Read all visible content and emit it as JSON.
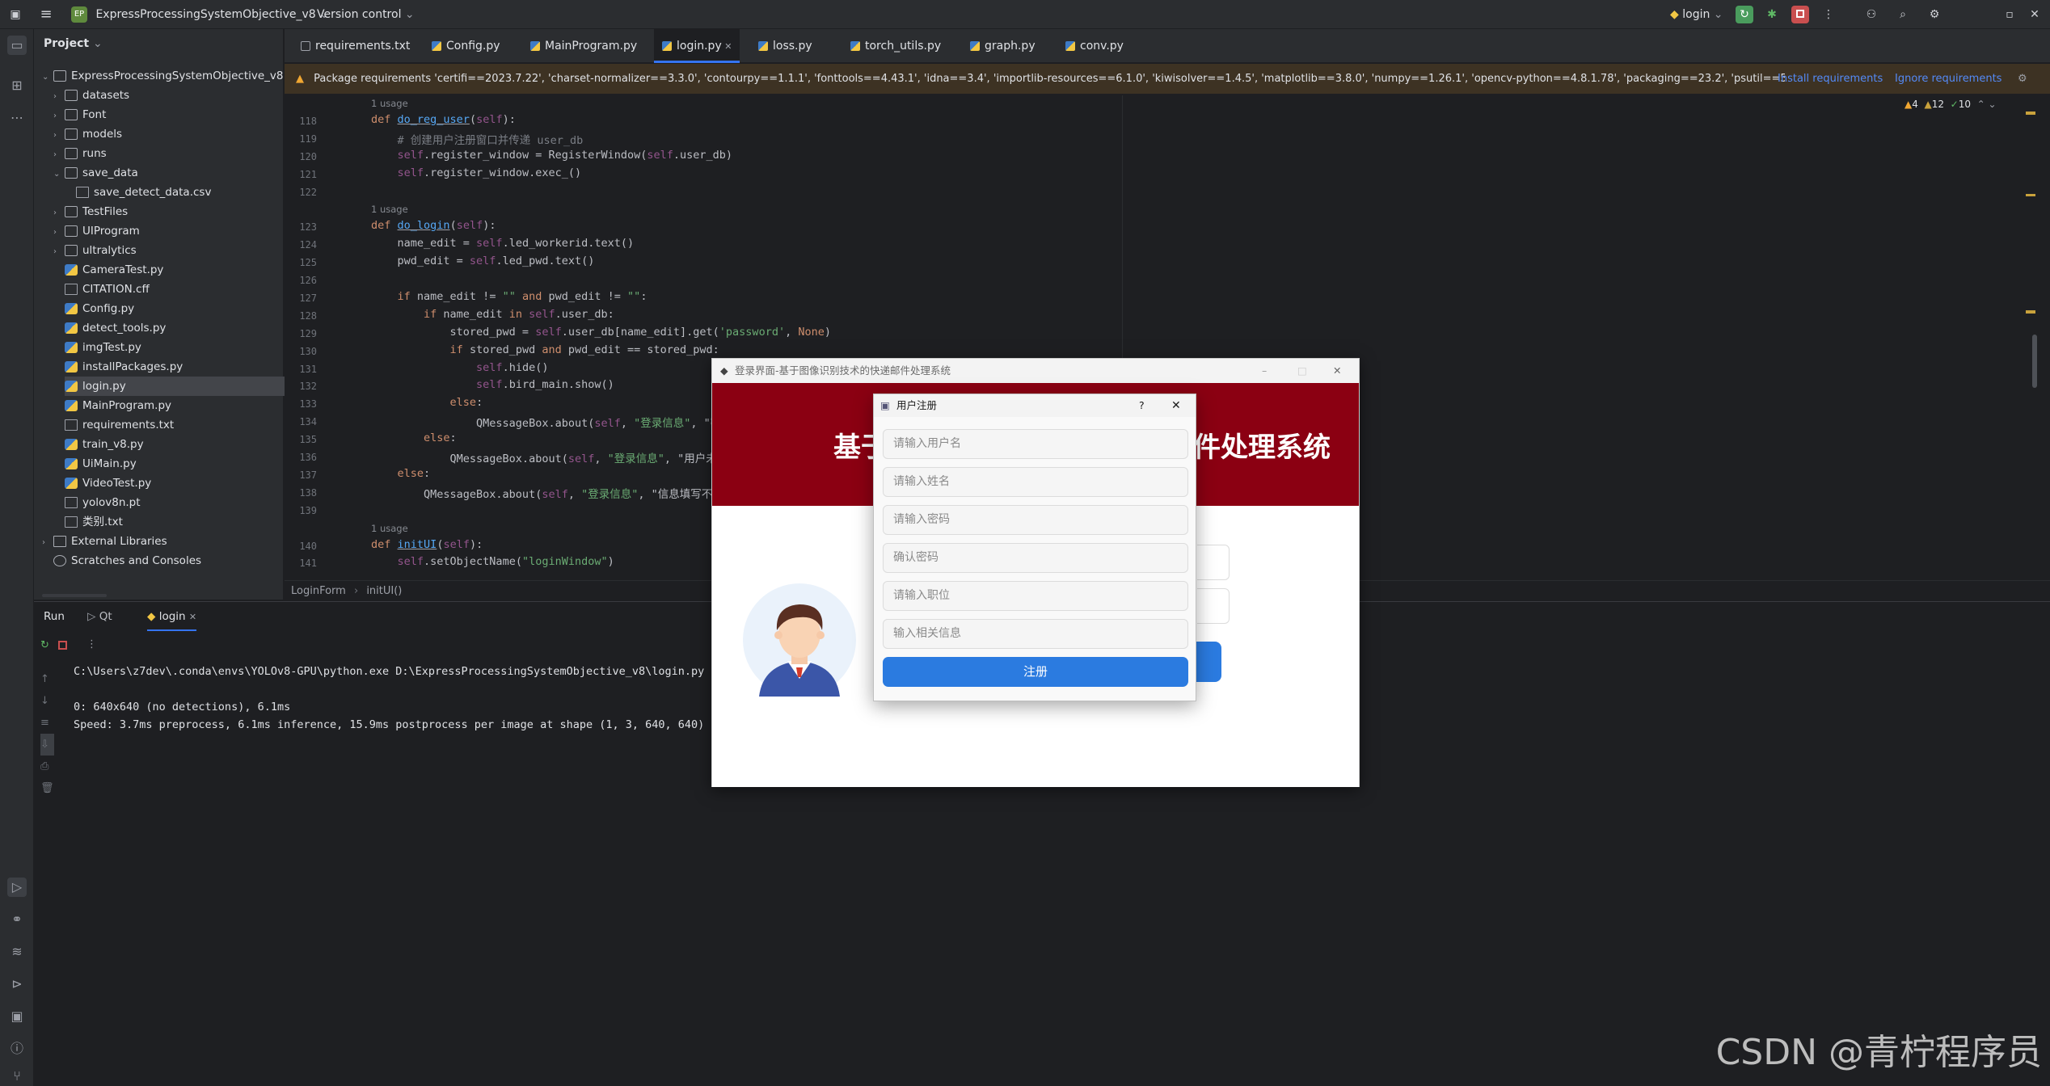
{
  "titlebar": {
    "project_badge": "EP",
    "project_name": "ExpressProcessingSystemObjective_v8",
    "vcs": "Version control",
    "run_config": "login"
  },
  "project_panel": {
    "header": "Project",
    "root": "ExpressProcessingSystemObjective_v8 [E",
    "items": [
      {
        "label": "datasets",
        "kind": "folder"
      },
      {
        "label": "Font",
        "kind": "folder"
      },
      {
        "label": "models",
        "kind": "folder"
      },
      {
        "label": "runs",
        "kind": "folder"
      },
      {
        "label": "save_data",
        "kind": "folder-open"
      },
      {
        "label": "save_detect_data.csv",
        "kind": "csv"
      },
      {
        "label": "TestFiles",
        "kind": "folder"
      },
      {
        "label": "UIProgram",
        "kind": "folder"
      },
      {
        "label": "ultralytics",
        "kind": "folder"
      },
      {
        "label": "CameraTest.py",
        "kind": "py"
      },
      {
        "label": "CITATION.cff",
        "kind": "txt"
      },
      {
        "label": "Config.py",
        "kind": "py"
      },
      {
        "label": "detect_tools.py",
        "kind": "py"
      },
      {
        "label": "imgTest.py",
        "kind": "py"
      },
      {
        "label": "installPackages.py",
        "kind": "py"
      },
      {
        "label": "login.py",
        "kind": "py"
      },
      {
        "label": "MainProgram.py",
        "kind": "py"
      },
      {
        "label": "requirements.txt",
        "kind": "txt"
      },
      {
        "label": "train_v8.py",
        "kind": "py"
      },
      {
        "label": "UiMain.py",
        "kind": "py"
      },
      {
        "label": "VideoTest.py",
        "kind": "py"
      },
      {
        "label": "yolov8n.pt",
        "kind": "txt"
      },
      {
        "label": "类别.txt",
        "kind": "txt"
      }
    ],
    "external": "External Libraries",
    "scratches": "Scratches and Consoles"
  },
  "tabs": [
    "requirements.txt",
    "Config.py",
    "MainProgram.py",
    "login.py",
    "loss.py",
    "torch_utils.py",
    "graph.py",
    "conv.py"
  ],
  "notification": {
    "text": "Package requirements 'certifi==2023.7.22', 'charset-normalizer==3.3.0', 'contourpy==1.1.1', 'fonttools==4.43.1', 'idna==3.4', 'importlib-resources==6.1.0', 'kiwisolver==1.4.5', 'matplotlib==3.8.0', 'numpy==1.26.1', 'opencv-python==4.8.1.78', 'packaging==23.2', 'psutil==5.9.6', 'py-cpui...",
    "install": "Install requirements",
    "ignore": "Ignore requirements"
  },
  "inspections": {
    "warnings": "4",
    "weak": "12",
    "ok": "10"
  },
  "code": {
    "usage": "1 usage",
    "lines": [
      {
        "n": "118",
        "text": "def do_reg_user(self):"
      },
      {
        "n": "119",
        "text": "    # 创建用户注册窗口并传递 user_db"
      },
      {
        "n": "120",
        "text": "    self.register_window = RegisterWindow(self.user_db)"
      },
      {
        "n": "121",
        "text": "    self.register_window.exec_()"
      },
      {
        "n": "122",
        "text": ""
      },
      {
        "n": "123",
        "text": "def do_login(self):"
      },
      {
        "n": "124",
        "text": "    name_edit = self.led_workerid.text()"
      },
      {
        "n": "125",
        "text": "    pwd_edit = self.led_pwd.text()"
      },
      {
        "n": "126",
        "text": ""
      },
      {
        "n": "127",
        "text": "    if name_edit != \"\" and pwd_edit != \"\":"
      },
      {
        "n": "128",
        "text": "        if name_edit in self.user_db:"
      },
      {
        "n": "129",
        "text": "            stored_pwd = self.user_db[name_edit].get('password', None)"
      },
      {
        "n": "130",
        "text": "            if stored_pwd and pwd_edit == stored_pwd:"
      },
      {
        "n": "131",
        "text": "                self.hide()"
      },
      {
        "n": "132",
        "text": "                self.bird_main.show()"
      },
      {
        "n": "133",
        "text": "            else:"
      },
      {
        "n": "134",
        "text": "                QMessageBox.about(self, \"登录信息\", \"密"
      },
      {
        "n": "135",
        "text": "        else:"
      },
      {
        "n": "136",
        "text": "            QMessageBox.about(self, \"登录信息\", \"用户未"
      },
      {
        "n": "137",
        "text": "    else:"
      },
      {
        "n": "138",
        "text": "        QMessageBox.about(self, \"登录信息\", \"信息填写不完"
      },
      {
        "n": "139",
        "text": ""
      },
      {
        "n": "140",
        "text": "def initUI(self):"
      },
      {
        "n": "141",
        "text": "    self.setObjectName(\"loginWindow\")"
      }
    ]
  },
  "breadcrumb": [
    "LoginForm",
    "initUI()"
  ],
  "run_panel": {
    "tabs": [
      "Run",
      "Qt",
      "login"
    ],
    "output": [
      "C:\\Users\\z7dev\\.conda\\envs\\YOLOv8-GPU\\python.exe D:\\ExpressProcessingSystemObjective_v8\\login.py",
      "",
      "0: 640x640 (no detections), 6.1ms",
      "Speed: 3.7ms preprocess, 6.1ms inference, 15.9ms postprocess per image at shape (1, 3, 640, 640)"
    ]
  },
  "login_window": {
    "title": "登录界面-基于图像识别技术的快递邮件处理系统",
    "banner_left": "基于",
    "banner_right": "件处理系统",
    "login_btn_partial": "录"
  },
  "register_dialog": {
    "title": "用户注册",
    "help": "?",
    "fields": [
      "请输入用户名",
      "请输入姓名",
      "请输入密码",
      "确认密码",
      "请输入职位",
      "输入相关信息"
    ],
    "submit": "注册"
  },
  "watermark": "CSDN @青柠程序员"
}
